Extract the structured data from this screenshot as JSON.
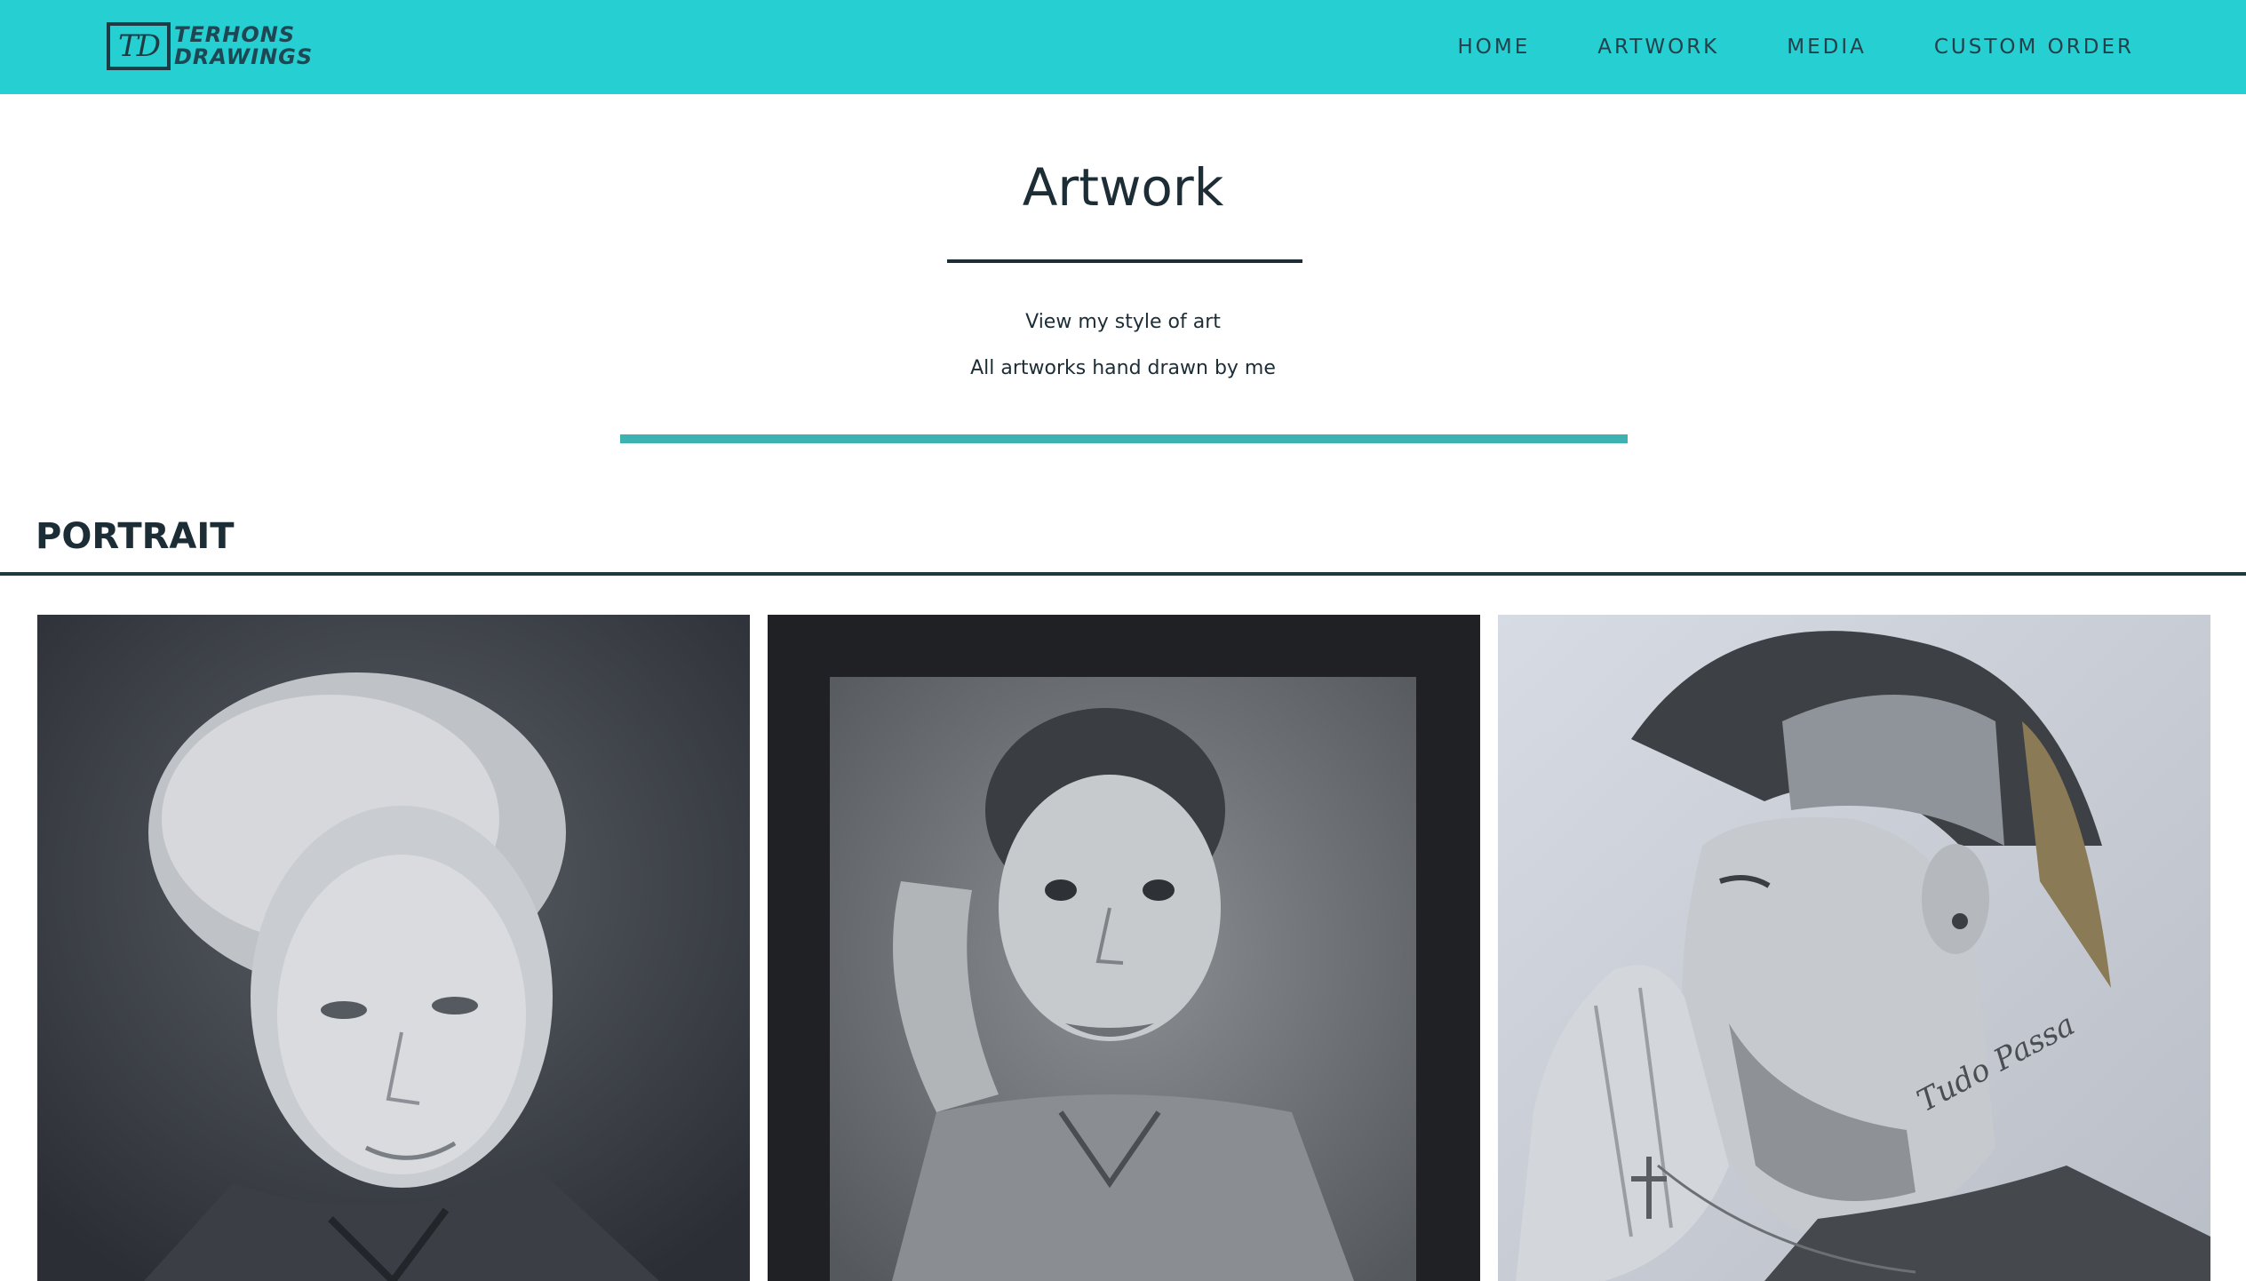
{
  "header": {
    "logo": {
      "monogram": "TD",
      "line1": "TERHONS",
      "line2": "DRAWINGS"
    },
    "nav": [
      {
        "label": "HOME"
      },
      {
        "label": "ARTWORK"
      },
      {
        "label": "MEDIA"
      },
      {
        "label": "CUSTOM ORDER"
      }
    ]
  },
  "intro": {
    "title": "Artwork",
    "line1": "View my style of art",
    "line2": "All artworks hand drawn by me"
  },
  "section": {
    "heading": "PORTRAIT"
  },
  "gallery": [
    {
      "icon": "pencil-portrait-boy-image"
    },
    {
      "icon": "pencil-portrait-toddler-image"
    },
    {
      "icon": "pencil-portrait-man-praying-image"
    }
  ],
  "colors": {
    "header_bg": "#26cfd1",
    "accent_rule": "#3eb1b1",
    "text_dark": "#1c2d36"
  }
}
